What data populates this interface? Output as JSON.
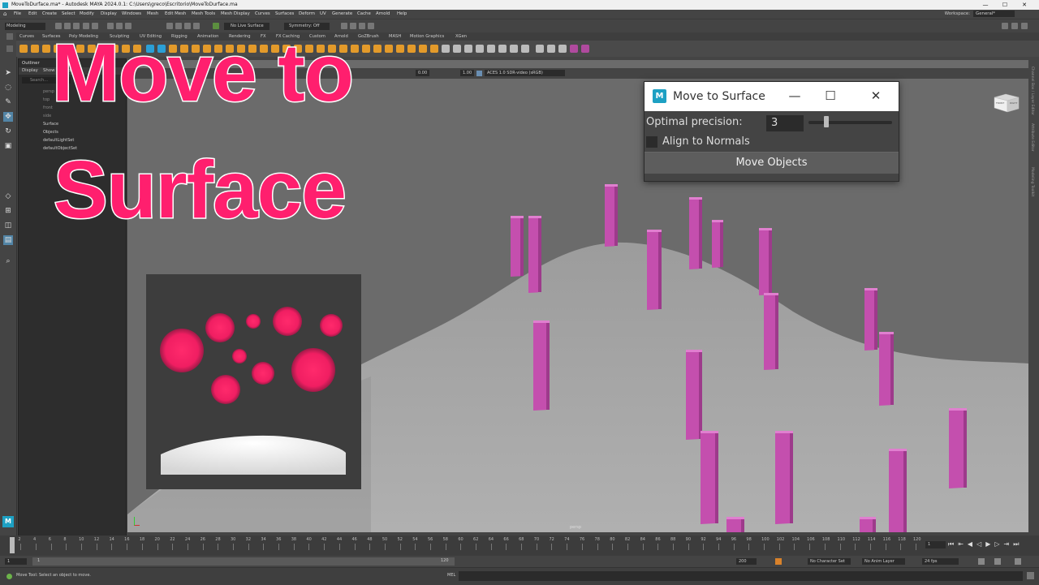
{
  "window": {
    "title": "MoveToDurface.ma* - Autodesk MAYA 2024.0.1: C:\\Users\\greco\\Escritorio\\MoveToDurface.ma",
    "controls": [
      "—",
      "☐",
      "✕"
    ]
  },
  "menubar": {
    "items": [
      "File",
      "Edit",
      "Create",
      "Select",
      "Modify",
      "Display",
      "Windows",
      "Mesh",
      "Edit Mesh",
      "Mesh Tools",
      "Mesh Display",
      "Curves",
      "Surfaces",
      "Deform",
      "UV",
      "Generate",
      "Cache",
      "Arnold",
      "Help"
    ],
    "workspace_label": "Workspace:",
    "workspace_value": "General*"
  },
  "statusline": {
    "mode": "Modeling",
    "live_surface": "No Live Surface",
    "symmetry": "Symmetry: Off"
  },
  "shelf": {
    "tabs": [
      "Curves",
      "Surfaces",
      "Poly Modeling",
      "Sculpting",
      "UV Editing",
      "Rigging",
      "Animation",
      "Rendering",
      "FX",
      "FX Caching",
      "Custom",
      "Arnold",
      "GoZBrush",
      "MASH",
      "Motion Graphics",
      "XGen"
    ]
  },
  "outliner": {
    "title": "Outliner",
    "menu": [
      "Display",
      "Show",
      "Help"
    ],
    "search_placeholder": "Search...",
    "items": [
      "persp",
      "top",
      "front",
      "side",
      "Surface",
      "Objects",
      "defaultLightSet",
      "defaultObjectSet"
    ]
  },
  "viewport": {
    "toolbar_value1": "0.00",
    "toolbar_value2": "1.00",
    "colorspace": "ACES 1.0 SDR-video (sRGB)",
    "camera_label": "persp",
    "viewcube_front": "FRONT",
    "viewcube_right": "RIGHT",
    "side_panel_labels": [
      "Channel Box / Layer Editor",
      "Attribute Editor",
      "Modeling Toolkit"
    ]
  },
  "overlay": {
    "line1": "Move to",
    "line2": "Surface"
  },
  "dialog": {
    "title": "Move to Surface",
    "logo": "M",
    "precision_label": "Optimal precision:",
    "precision_value": "3",
    "precision_slider": 0.2,
    "align_label": "Align to Normals",
    "align_checked": false,
    "move_button": "Move Objects"
  },
  "timeline": {
    "ticks": [
      "1",
      "2",
      "4",
      "6",
      "8",
      "10",
      "12",
      "14",
      "16",
      "18",
      "20",
      "22",
      "24",
      "26",
      "28",
      "30",
      "32",
      "34",
      "36",
      "38",
      "40",
      "42",
      "44",
      "46",
      "48",
      "50",
      "52",
      "54",
      "56",
      "58",
      "60",
      "62",
      "64",
      "66",
      "68",
      "70",
      "72",
      "74",
      "76",
      "78",
      "80",
      "82",
      "84",
      "86",
      "88",
      "90",
      "92",
      "94",
      "96",
      "98",
      "100",
      "102",
      "104",
      "106",
      "108",
      "110",
      "112",
      "114",
      "116",
      "118",
      "120"
    ],
    "current_frame": "1",
    "range_start": "1",
    "range_start2": "1",
    "range_end_inner": "120",
    "range_end": "200",
    "character_set": "No Character Set",
    "anim_layer": "No Anim Layer",
    "fps": "24 fps"
  },
  "commandline": {
    "help": "Move Tool: Select an object to move.",
    "lang": "MEL"
  },
  "colors": {
    "accent_pink": "#ff1f6e",
    "pillar": "#c44fae",
    "dialog_logo": "#1da0c3"
  }
}
